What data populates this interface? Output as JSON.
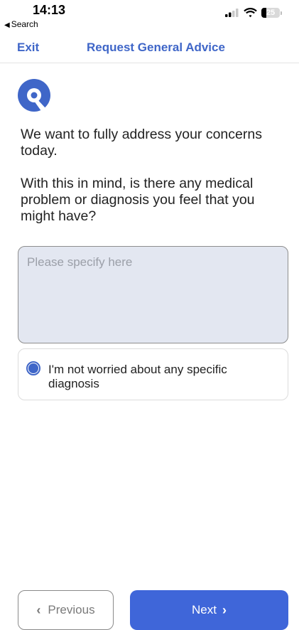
{
  "status_bar": {
    "time": "14:13",
    "back_label": "Search",
    "battery_percent": "25",
    "battery_level": 0.25,
    "icons": [
      "cellular-signal-icon",
      "wifi-icon",
      "battery-icon"
    ]
  },
  "nav": {
    "exit_label": "Exit",
    "title": "Request General Advice"
  },
  "logo": {
    "icon": "app-logo-icon",
    "color": "#3f66c8"
  },
  "question": {
    "intro": "We want to fully address your concerns today.",
    "prompt": "With this in mind, is there any medical problem or diagnosis you feel that you might have?"
  },
  "specify": {
    "placeholder": "Please specify here",
    "value": ""
  },
  "option": {
    "label": "I'm not worried about any specific diagnosis",
    "selected": true
  },
  "footer": {
    "previous_label": "Previous",
    "next_label": "Next"
  },
  "colors": {
    "accent": "#3f66c8",
    "next_button": "#3f66d9",
    "input_background": "#e3e7f1"
  }
}
